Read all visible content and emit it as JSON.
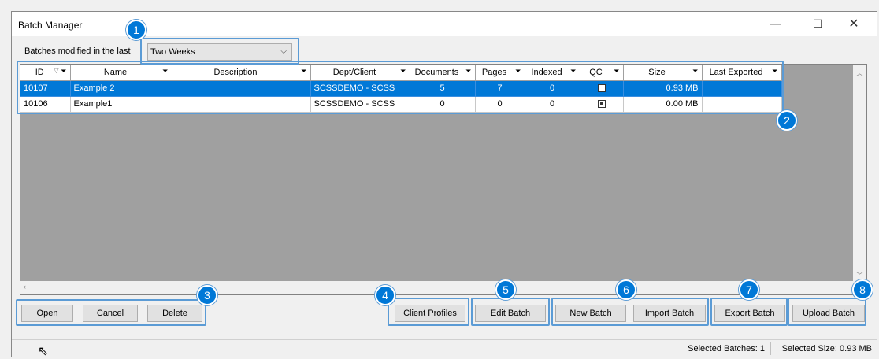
{
  "window": {
    "title": "Batch Manager",
    "minimize_icon": "minimize-icon",
    "maximize_icon": "maximize-icon",
    "close_icon": "close-icon"
  },
  "filter": {
    "label": "Batches modified in the last",
    "selected": "Two Weeks"
  },
  "grid": {
    "columns": [
      "ID",
      "Name",
      "Description",
      "Dept/Client",
      "Documents",
      "Pages",
      "Indexed",
      "QC",
      "Size",
      "Last Exported"
    ],
    "rows": [
      {
        "id": "10107",
        "name": "Example 2",
        "description": "",
        "dept": "SCSSDEMO - SCSS",
        "documents": "5",
        "pages": "7",
        "indexed": "0",
        "qc": false,
        "size": "0.93 MB",
        "last_exported": "",
        "selected": true
      },
      {
        "id": "10106",
        "name": "Example1",
        "description": "",
        "dept": "SCSSDEMO - SCSS",
        "documents": "0",
        "pages": "0",
        "indexed": "0",
        "qc": true,
        "size": "0.00 MB",
        "last_exported": "",
        "selected": false
      }
    ]
  },
  "buttons": {
    "open": "Open",
    "cancel": "Cancel",
    "delete": "Delete",
    "client_profiles": "Client Profiles",
    "edit_batch": "Edit Batch",
    "new_batch": "New Batch",
    "import_batch": "Import Batch",
    "export_batch": "Export Batch",
    "upload_batch": "Upload Batch"
  },
  "badges": [
    "1",
    "2",
    "3",
    "4",
    "5",
    "6",
    "7",
    "8"
  ],
  "status": {
    "selected_batches": "Selected Batches: 1",
    "selected_size": "Selected Size: 0.93 MB"
  },
  "colors": {
    "selection": "#0078d7",
    "highlight": "#5b9bd5",
    "badge": "#0078d7"
  }
}
